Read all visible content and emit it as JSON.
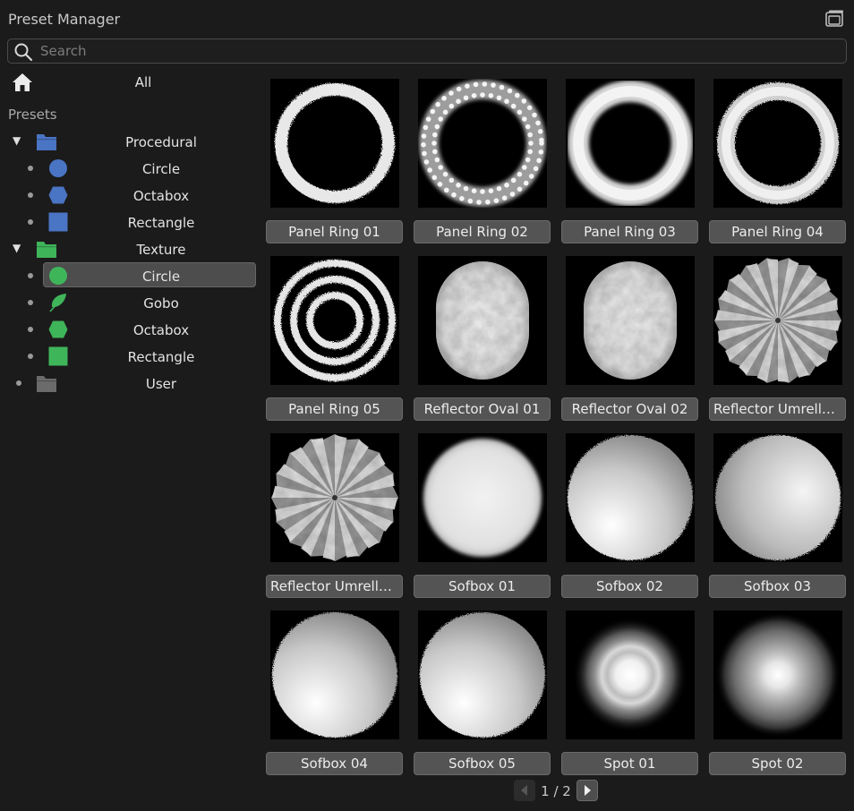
{
  "window": {
    "title": "Preset Manager"
  },
  "search": {
    "placeholder": "Search",
    "value": ""
  },
  "nav": {
    "all_label": "All",
    "presets_label": "Presets"
  },
  "tree": [
    {
      "label": "Procedural",
      "kind": "folder",
      "color": "#4a74c4",
      "expanded": true
    },
    {
      "label": "Circle",
      "kind": "circle",
      "color": "#4a74c4"
    },
    {
      "label": "Octabox",
      "kind": "octagon",
      "color": "#4a74c4"
    },
    {
      "label": "Rectangle",
      "kind": "square",
      "color": "#4a74c4"
    },
    {
      "label": "Texture",
      "kind": "folder",
      "color": "#3fb55a",
      "expanded": true
    },
    {
      "label": "Circle",
      "kind": "circle",
      "color": "#3fb55a",
      "selected": true
    },
    {
      "label": "Gobo",
      "kind": "leaf",
      "color": "#3fb55a"
    },
    {
      "label": "Octabox",
      "kind": "octagon",
      "color": "#3fb55a"
    },
    {
      "label": "Rectangle",
      "kind": "square",
      "color": "#3fb55a"
    },
    {
      "label": "User",
      "kind": "folder",
      "color": "#6b6b6b",
      "expanded": false
    }
  ],
  "presets": [
    {
      "label": "Panel Ring 01",
      "thumb": "ring-rough"
    },
    {
      "label": "Panel Ring 02",
      "thumb": "ring-dotted"
    },
    {
      "label": "Panel Ring 03",
      "thumb": "ring-soft"
    },
    {
      "label": "Panel Ring 04",
      "thumb": "ring-soft-thin"
    },
    {
      "label": "Panel Ring 05",
      "thumb": "rings-concentric"
    },
    {
      "label": "Reflector Oval 01",
      "thumb": "oval-crinkled"
    },
    {
      "label": "Reflector Oval 02",
      "thumb": "oval-crinkled-2"
    },
    {
      "label": "Reflector Umrella ...",
      "thumb": "umbrella"
    },
    {
      "label": "Reflector Umrella ...",
      "thumb": "umbrella-2"
    },
    {
      "label": "Sofbox 01",
      "thumb": "disc-soft"
    },
    {
      "label": "Sofbox 02",
      "thumb": "disc-grad"
    },
    {
      "label": "Sofbox 03",
      "thumb": "disc-grad-2"
    },
    {
      "label": "Sofbox 04",
      "thumb": "disc-grad-3"
    },
    {
      "label": "Sofbox 05",
      "thumb": "disc-grad-4"
    },
    {
      "label": "Spot 01",
      "thumb": "spot"
    },
    {
      "label": "Spot 02",
      "thumb": "spot-2"
    }
  ],
  "pagination": {
    "text": "1 / 2",
    "current": 1,
    "total": 2
  }
}
